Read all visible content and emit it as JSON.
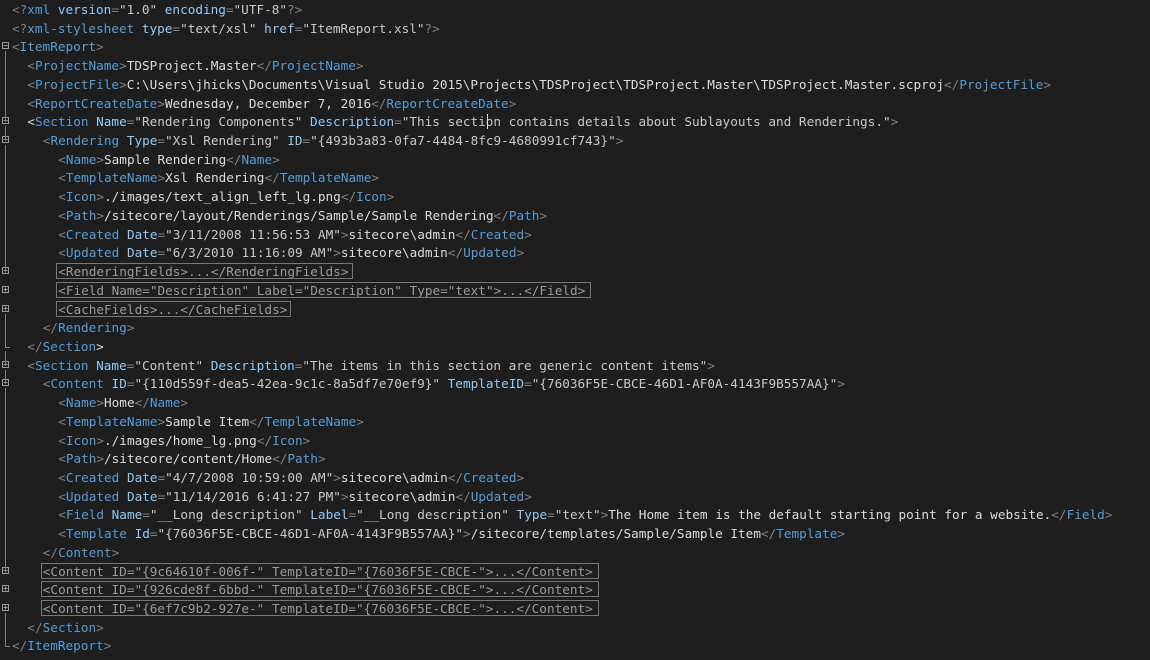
{
  "editor": {
    "lines": [
      {
        "indent": 0,
        "tokens": [
          [
            "gray",
            "<?"
          ],
          [
            "blue",
            "xml"
          ],
          [
            "attr",
            " version"
          ],
          [
            "gray",
            "="
          ],
          [
            "val",
            "\"1.0\""
          ],
          [
            "attr",
            " encoding"
          ],
          [
            "gray",
            "="
          ],
          [
            "val",
            "\"UTF-8\""
          ],
          [
            "gray",
            "?>"
          ]
        ]
      },
      {
        "indent": 0,
        "tokens": [
          [
            "gray",
            "<?"
          ],
          [
            "blue",
            "xml-stylesheet"
          ],
          [
            "attr",
            " type"
          ],
          [
            "gray",
            "="
          ],
          [
            "val",
            "\"text/xsl\""
          ],
          [
            "attr",
            " href"
          ],
          [
            "gray",
            "="
          ],
          [
            "val",
            "\"ItemReport.xsl\""
          ],
          [
            "gray",
            "?>"
          ]
        ]
      },
      {
        "indent": 0,
        "fold": "minus",
        "tokens": [
          [
            "gray",
            "<"
          ],
          [
            "blue",
            "ItemReport"
          ],
          [
            "gray",
            ">"
          ]
        ]
      },
      {
        "indent": 2,
        "tokens": [
          [
            "gray",
            "<"
          ],
          [
            "blue",
            "ProjectName"
          ],
          [
            "gray",
            ">"
          ],
          [
            "text",
            "TDSProject.Master"
          ],
          [
            "gray",
            "</"
          ],
          [
            "blue",
            "ProjectName"
          ],
          [
            "gray",
            ">"
          ]
        ]
      },
      {
        "indent": 2,
        "tokens": [
          [
            "gray",
            "<"
          ],
          [
            "blue",
            "ProjectFile"
          ],
          [
            "gray",
            ">"
          ],
          [
            "text",
            "C:\\Users\\jhicks\\Documents\\Visual Studio 2015\\Projects\\TDSProject\\TDSProject.Master\\TDSProject.Master.scproj"
          ],
          [
            "gray",
            "</"
          ],
          [
            "blue",
            "ProjectFile"
          ],
          [
            "gray",
            ">"
          ]
        ]
      },
      {
        "indent": 2,
        "tokens": [
          [
            "gray",
            "<"
          ],
          [
            "blue",
            "ReportCreateDate"
          ],
          [
            "gray",
            ">"
          ],
          [
            "text",
            "Wednesday, December 7, 2016"
          ],
          [
            "gray",
            "</"
          ],
          [
            "blue",
            "ReportCreateDate"
          ],
          [
            "gray",
            ">"
          ]
        ]
      },
      {
        "indent": 2,
        "fold": "minus",
        "tokens": [
          [
            "hl",
            "<"
          ],
          [
            "blue",
            "Section"
          ],
          [
            "attr",
            " Name"
          ],
          [
            "gray",
            "="
          ],
          [
            "val",
            "\"Rendering Components\""
          ],
          [
            "attr",
            " Description"
          ],
          [
            "gray",
            "="
          ],
          [
            "val",
            "\"This section contains details about Sublayouts and Renderings.\""
          ],
          [
            "gray",
            ">"
          ]
        ]
      },
      {
        "indent": 4,
        "fold": "minus",
        "tokens": [
          [
            "gray",
            "<"
          ],
          [
            "blue",
            "Rendering"
          ],
          [
            "attr",
            " Type"
          ],
          [
            "gray",
            "="
          ],
          [
            "val",
            "\"Xsl Rendering\""
          ],
          [
            "attr",
            " ID"
          ],
          [
            "gray",
            "="
          ],
          [
            "val",
            "\"{493b3a83-0fa7-4484-8fc9-4680991cf743}\""
          ],
          [
            "gray",
            ">"
          ]
        ]
      },
      {
        "indent": 6,
        "tokens": [
          [
            "gray",
            "<"
          ],
          [
            "blue",
            "Name"
          ],
          [
            "gray",
            ">"
          ],
          [
            "text",
            "Sample Rendering"
          ],
          [
            "gray",
            "</"
          ],
          [
            "blue",
            "Name"
          ],
          [
            "gray",
            ">"
          ]
        ]
      },
      {
        "indent": 6,
        "tokens": [
          [
            "gray",
            "<"
          ],
          [
            "blue",
            "TemplateName"
          ],
          [
            "gray",
            ">"
          ],
          [
            "text",
            "Xsl Rendering"
          ],
          [
            "gray",
            "</"
          ],
          [
            "blue",
            "TemplateName"
          ],
          [
            "gray",
            ">"
          ]
        ]
      },
      {
        "indent": 6,
        "tokens": [
          [
            "gray",
            "<"
          ],
          [
            "blue",
            "Icon"
          ],
          [
            "gray",
            ">"
          ],
          [
            "text",
            "./images/text_align_left_lg.png"
          ],
          [
            "gray",
            "</"
          ],
          [
            "blue",
            "Icon"
          ],
          [
            "gray",
            ">"
          ]
        ]
      },
      {
        "indent": 6,
        "tokens": [
          [
            "gray",
            "<"
          ],
          [
            "blue",
            "Path"
          ],
          [
            "gray",
            ">"
          ],
          [
            "text",
            "/sitecore/layout/Renderings/Sample/Sample Rendering"
          ],
          [
            "gray",
            "</"
          ],
          [
            "blue",
            "Path"
          ],
          [
            "gray",
            ">"
          ]
        ]
      },
      {
        "indent": 6,
        "tokens": [
          [
            "gray",
            "<"
          ],
          [
            "blue",
            "Created"
          ],
          [
            "attr",
            " Date"
          ],
          [
            "gray",
            "="
          ],
          [
            "val",
            "\"3/11/2008 11:56:53 AM\""
          ],
          [
            "gray",
            ">"
          ],
          [
            "text",
            "sitecore\\admin"
          ],
          [
            "gray",
            "</"
          ],
          [
            "blue",
            "Created"
          ],
          [
            "gray",
            ">"
          ]
        ]
      },
      {
        "indent": 6,
        "tokens": [
          [
            "gray",
            "<"
          ],
          [
            "blue",
            "Updated"
          ],
          [
            "attr",
            " Date"
          ],
          [
            "gray",
            "="
          ],
          [
            "val",
            "\"6/3/2010 11:16:09 AM\""
          ],
          [
            "gray",
            ">"
          ],
          [
            "text",
            "sitecore\\admin"
          ],
          [
            "gray",
            "</"
          ],
          [
            "blue",
            "Updated"
          ],
          [
            "gray",
            ">"
          ]
        ]
      },
      {
        "indent": 6,
        "fold": "plus",
        "collapsed": true,
        "tokens": [
          [
            "coll",
            "<RenderingFields>...</RenderingFields>"
          ]
        ]
      },
      {
        "indent": 6,
        "fold": "plus",
        "collapsed": true,
        "tokens": [
          [
            "coll",
            "<Field Name=\"Description\" Label=\"Description\" Type=\"text\">...</Field>"
          ]
        ]
      },
      {
        "indent": 6,
        "fold": "plus",
        "collapsed": true,
        "tokens": [
          [
            "coll",
            "<CacheFields>...</CacheFields>"
          ]
        ]
      },
      {
        "indent": 4,
        "tokens": [
          [
            "gray",
            "</"
          ],
          [
            "blue",
            "Rendering"
          ],
          [
            "gray",
            ">"
          ]
        ]
      },
      {
        "indent": 2,
        "endguide": true,
        "tokens": [
          [
            "gray",
            "</"
          ],
          [
            "blue",
            "Section"
          ],
          [
            "hl",
            ">"
          ]
        ]
      },
      {
        "indent": 2,
        "fold": "minus",
        "tokens": [
          [
            "gray",
            "<"
          ],
          [
            "blue",
            "Section"
          ],
          [
            "attr",
            " Name"
          ],
          [
            "gray",
            "="
          ],
          [
            "val",
            "\"Content\""
          ],
          [
            "attr",
            " Description"
          ],
          [
            "gray",
            "="
          ],
          [
            "val",
            "\"The items in this section are generic content items\""
          ],
          [
            "gray",
            ">"
          ]
        ]
      },
      {
        "indent": 4,
        "fold": "minus",
        "tokens": [
          [
            "gray",
            "<"
          ],
          [
            "blue",
            "Content"
          ],
          [
            "attr",
            " ID"
          ],
          [
            "gray",
            "="
          ],
          [
            "val",
            "\"{110d559f-dea5-42ea-9c1c-8a5df7e70ef9}\""
          ],
          [
            "attr",
            " TemplateID"
          ],
          [
            "gray",
            "="
          ],
          [
            "val",
            "\"{76036F5E-CBCE-46D1-AF0A-4143F9B557AA}\""
          ],
          [
            "gray",
            ">"
          ]
        ]
      },
      {
        "indent": 6,
        "tokens": [
          [
            "gray",
            "<"
          ],
          [
            "blue",
            "Name"
          ],
          [
            "gray",
            ">"
          ],
          [
            "text",
            "Home"
          ],
          [
            "gray",
            "</"
          ],
          [
            "blue",
            "Name"
          ],
          [
            "gray",
            ">"
          ]
        ]
      },
      {
        "indent": 6,
        "tokens": [
          [
            "gray",
            "<"
          ],
          [
            "blue",
            "TemplateName"
          ],
          [
            "gray",
            ">"
          ],
          [
            "text",
            "Sample Item"
          ],
          [
            "gray",
            "</"
          ],
          [
            "blue",
            "TemplateName"
          ],
          [
            "gray",
            ">"
          ]
        ]
      },
      {
        "indent": 6,
        "tokens": [
          [
            "gray",
            "<"
          ],
          [
            "blue",
            "Icon"
          ],
          [
            "gray",
            ">"
          ],
          [
            "text",
            "./images/home_lg.png"
          ],
          [
            "gray",
            "</"
          ],
          [
            "blue",
            "Icon"
          ],
          [
            "gray",
            ">"
          ]
        ]
      },
      {
        "indent": 6,
        "tokens": [
          [
            "gray",
            "<"
          ],
          [
            "blue",
            "Path"
          ],
          [
            "gray",
            ">"
          ],
          [
            "text",
            "/sitecore/content/Home"
          ],
          [
            "gray",
            "</"
          ],
          [
            "blue",
            "Path"
          ],
          [
            "gray",
            ">"
          ]
        ]
      },
      {
        "indent": 6,
        "tokens": [
          [
            "gray",
            "<"
          ],
          [
            "blue",
            "Created"
          ],
          [
            "attr",
            " Date"
          ],
          [
            "gray",
            "="
          ],
          [
            "val",
            "\"4/7/2008 10:59:00 AM\""
          ],
          [
            "gray",
            ">"
          ],
          [
            "text",
            "sitecore\\admin"
          ],
          [
            "gray",
            "</"
          ],
          [
            "blue",
            "Created"
          ],
          [
            "gray",
            ">"
          ]
        ]
      },
      {
        "indent": 6,
        "tokens": [
          [
            "gray",
            "<"
          ],
          [
            "blue",
            "Updated"
          ],
          [
            "attr",
            " Date"
          ],
          [
            "gray",
            "="
          ],
          [
            "val",
            "\"11/14/2016 6:41:27 PM\""
          ],
          [
            "gray",
            ">"
          ],
          [
            "text",
            "sitecore\\admin"
          ],
          [
            "gray",
            "</"
          ],
          [
            "blue",
            "Updated"
          ],
          [
            "gray",
            ">"
          ]
        ]
      },
      {
        "indent": 6,
        "tokens": [
          [
            "gray",
            "<"
          ],
          [
            "blue",
            "Field"
          ],
          [
            "attr",
            " Name"
          ],
          [
            "gray",
            "="
          ],
          [
            "val",
            "\"__Long description\""
          ],
          [
            "attr",
            " Label"
          ],
          [
            "gray",
            "="
          ],
          [
            "val",
            "\"__Long description\""
          ],
          [
            "attr",
            " Type"
          ],
          [
            "gray",
            "="
          ],
          [
            "val",
            "\"text\""
          ],
          [
            "gray",
            ">"
          ],
          [
            "text",
            "The Home item is the default starting point for a website."
          ],
          [
            "gray",
            "</"
          ],
          [
            "blue",
            "Field"
          ],
          [
            "gray",
            ">"
          ]
        ]
      },
      {
        "indent": 6,
        "tokens": [
          [
            "gray",
            "<"
          ],
          [
            "blue",
            "Template"
          ],
          [
            "attr",
            " Id"
          ],
          [
            "gray",
            "="
          ],
          [
            "val",
            "\"{76036F5E-CBCE-46D1-AF0A-4143F9B557AA}\""
          ],
          [
            "gray",
            ">"
          ],
          [
            "text",
            "/sitecore/templates/Sample/Sample Item"
          ],
          [
            "gray",
            "</"
          ],
          [
            "blue",
            "Template"
          ],
          [
            "gray",
            ">"
          ]
        ]
      },
      {
        "indent": 4,
        "tokens": [
          [
            "gray",
            "</"
          ],
          [
            "blue",
            "Content"
          ],
          [
            "gray",
            ">"
          ]
        ]
      },
      {
        "indent": 4,
        "fold": "plus",
        "collapsed": true,
        "tokens": [
          [
            "coll",
            "<Content ID=\"{9c64610f-006f-\" TemplateID=\"{76036F5E-CBCE-\">...</Content>"
          ]
        ]
      },
      {
        "indent": 4,
        "fold": "plus",
        "collapsed": true,
        "tokens": [
          [
            "coll",
            "<Content ID=\"{926cde8f-6bbd-\" TemplateID=\"{76036F5E-CBCE-\">...</Content>"
          ]
        ]
      },
      {
        "indent": 4,
        "fold": "plus",
        "collapsed": true,
        "tokens": [
          [
            "coll",
            "<Content ID=\"{6ef7c9b2-927e-\" TemplateID=\"{76036F5E-CBCE-\">...</Content>"
          ]
        ]
      },
      {
        "indent": 2,
        "tokens": [
          [
            "gray",
            "</"
          ],
          [
            "blue",
            "Section"
          ],
          [
            "gray",
            ">"
          ]
        ]
      },
      {
        "indent": 0,
        "endguide": true,
        "tokens": [
          [
            "gray",
            "</"
          ],
          [
            "blue",
            "ItemReport"
          ],
          [
            "gray",
            ">"
          ]
        ]
      }
    ]
  }
}
